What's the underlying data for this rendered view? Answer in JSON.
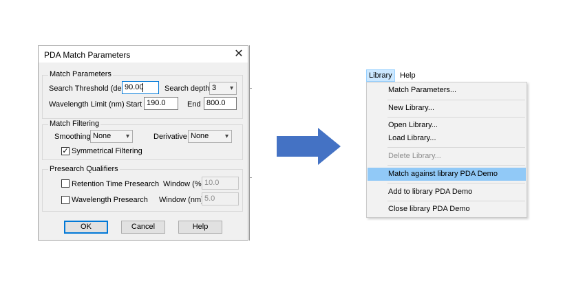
{
  "dialog": {
    "title": "PDA Match Parameters",
    "match_parameters": {
      "group_label": "Match Parameters",
      "search_threshold_label": "Search Threshold (deg)",
      "search_threshold_value": "90.00",
      "search_depth_label": "Search depth",
      "search_depth_value": "3",
      "wavelength_limit_label": "Wavelength Limit (nm)",
      "start_label": "Start",
      "start_value": "190.0",
      "end_label": "End",
      "end_value": "800.0"
    },
    "match_filtering": {
      "group_label": "Match Filtering",
      "smoothing_label": "Smoothing",
      "smoothing_value": "None",
      "derivative_label": "Derivative",
      "derivative_value": "None",
      "symmetrical_label": "Symmetrical Filtering",
      "symmetrical_checked": true
    },
    "presearch": {
      "group_label": "Presearch Qualifiers",
      "retention_label": "Retention Time Presearch",
      "retention_checked": false,
      "window_pct_label": "Window (%)",
      "window_pct_value": "10.0",
      "wavelength_label": "Wavelength Presearch",
      "wavelength_checked": false,
      "window_nm_label": "Window (nm)",
      "window_nm_value": "5.0"
    },
    "buttons": {
      "ok": "OK",
      "cancel": "Cancel",
      "help": "Help"
    }
  },
  "arrow": {
    "color": "#4472c4"
  },
  "menu": {
    "bar": [
      {
        "label": "Library"
      },
      {
        "label": "Help"
      }
    ],
    "items": [
      {
        "label": "Match Parameters..."
      },
      {
        "label": "New Library..."
      },
      {
        "label": "Open Library..."
      },
      {
        "label": "Load Library..."
      },
      {
        "label": "Delete Library..."
      },
      {
        "label": "Match against library PDA Demo"
      },
      {
        "label": "Add to library PDA Demo"
      },
      {
        "label": "Close library PDA Demo"
      }
    ]
  }
}
